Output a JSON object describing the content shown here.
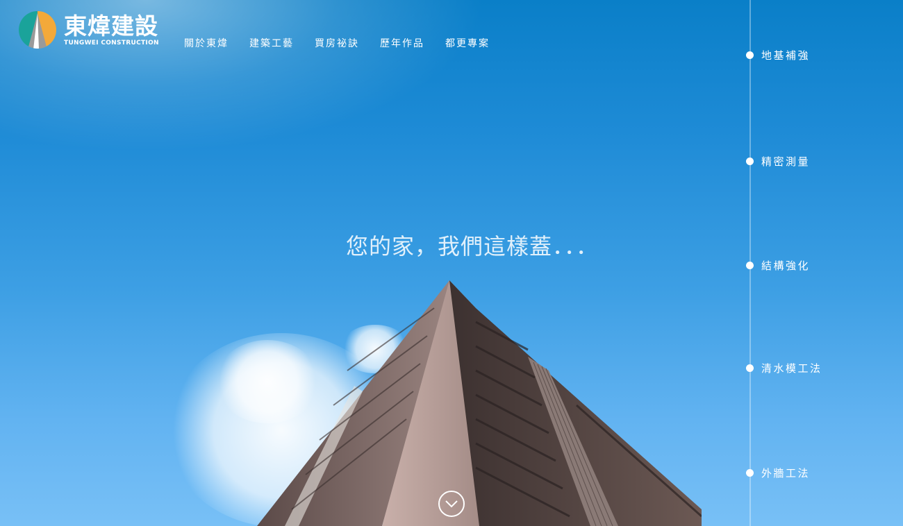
{
  "brand": {
    "name_cn": "東煒建設",
    "name_en": "TUNGWEI CONSTRUCTION",
    "colors": {
      "teal": "#1aa39a",
      "orange": "#f3a93a",
      "gray": "#8d8d8d"
    }
  },
  "nav": {
    "items": [
      {
        "label": "關於東煒"
      },
      {
        "label": "建築工藝"
      },
      {
        "label": "買房祕訣"
      },
      {
        "label": "歷年作品"
      },
      {
        "label": "都更專案"
      }
    ]
  },
  "hero": {
    "tagline": "您的家，我們這樣蓋．．．",
    "scroll_icon": "chevron-down-icon"
  },
  "timeline": {
    "items": [
      {
        "label": "地基補強"
      },
      {
        "label": "精密測量"
      },
      {
        "label": "結構強化"
      },
      {
        "label": "清水模工法"
      },
      {
        "label": "外牆工法"
      }
    ]
  }
}
